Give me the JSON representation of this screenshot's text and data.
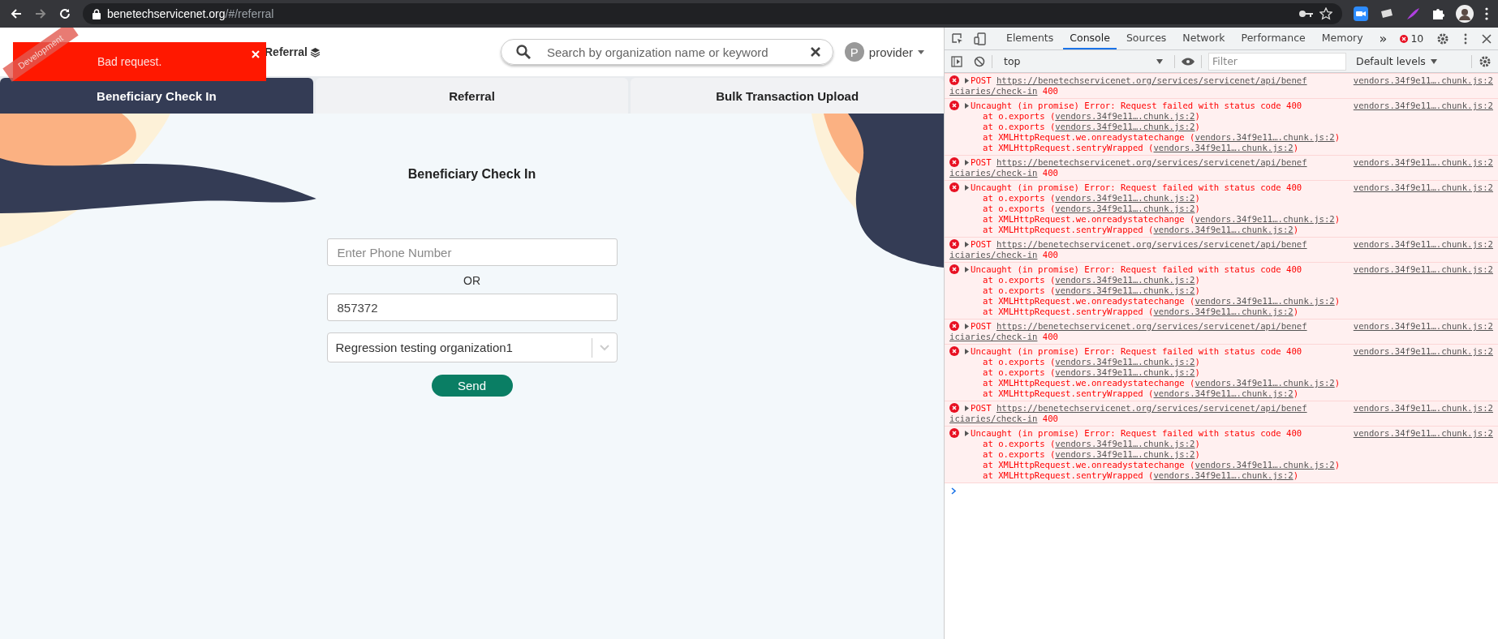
{
  "browser": {
    "url_host": "benetechservicenet.org",
    "url_path": "/#/referral"
  },
  "ribbon": {
    "label": "Development"
  },
  "toast": {
    "message": "Bad request."
  },
  "header": {
    "nav_link": "Referral",
    "search": {
      "placeholder": "Search by organization name or keyword"
    },
    "user": {
      "initial": "P",
      "name": "provider"
    }
  },
  "tabs": [
    {
      "label": "Beneficiary Check In",
      "selected": true
    },
    {
      "label": "Referral",
      "selected": false
    },
    {
      "label": "Bulk Transaction Upload",
      "selected": false
    }
  ],
  "form": {
    "title": "Beneficiary Check In",
    "phone": {
      "placeholder": "Enter Phone Number"
    },
    "separator": "OR",
    "beneficiary_id": {
      "value": "857372"
    },
    "organization": {
      "value": "Regression testing organization1"
    },
    "submit": "Send"
  },
  "devtools": {
    "tabs": [
      {
        "label": "Elements",
        "selected": false
      },
      {
        "label": "Console",
        "selected": true
      },
      {
        "label": "Sources",
        "selected": false
      },
      {
        "label": "Network",
        "selected": false
      },
      {
        "label": "Performance",
        "selected": false
      },
      {
        "label": "Memory",
        "selected": false
      }
    ],
    "more": "»",
    "error_count": "10",
    "context": "top",
    "filter": {
      "placeholder": "Filter"
    },
    "levels": "Default levels",
    "messages": [
      {
        "kind": "request",
        "method": "POST",
        "url_lines": [
          "https://benetechservicenet.org/services/servicenet/api/benef",
          "iciaries/check-in"
        ],
        "status": "400",
        "source": "vendors.34f9e11….chunk.js:2"
      },
      {
        "kind": "error",
        "message": "Uncaught (in promise) Error: Request failed with status code 400",
        "source": "vendors.34f9e11….chunk.js:2",
        "frames": [
          {
            "call": "at o.exports (",
            "src": "vendors.34f9e11….chunk.js:2",
            "close": ")"
          },
          {
            "call": "at o.exports (",
            "src": "vendors.34f9e11….chunk.js:2",
            "close": ")"
          },
          {
            "call": "at XMLHttpRequest.we.onreadystatechange (",
            "src": "vendors.34f9e11….chunk.js:2",
            "close": ")"
          },
          {
            "call": "at XMLHttpRequest.sentryWrapped (",
            "src": "vendors.34f9e11….chunk.js:2",
            "close": ")"
          }
        ]
      },
      {
        "kind": "request",
        "method": "POST",
        "url_lines": [
          "https://benetechservicenet.org/services/servicenet/api/benef",
          "iciaries/check-in"
        ],
        "status": "400",
        "source": "vendors.34f9e11….chunk.js:2"
      },
      {
        "kind": "error",
        "message": "Uncaught (in promise) Error: Request failed with status code 400",
        "source": "vendors.34f9e11….chunk.js:2",
        "frames": [
          {
            "call": "at o.exports (",
            "src": "vendors.34f9e11….chunk.js:2",
            "close": ")"
          },
          {
            "call": "at o.exports (",
            "src": "vendors.34f9e11….chunk.js:2",
            "close": ")"
          },
          {
            "call": "at XMLHttpRequest.we.onreadystatechange (",
            "src": "vendors.34f9e11….chunk.js:2",
            "close": ")"
          },
          {
            "call": "at XMLHttpRequest.sentryWrapped (",
            "src": "vendors.34f9e11….chunk.js:2",
            "close": ")"
          }
        ]
      },
      {
        "kind": "request",
        "method": "POST",
        "url_lines": [
          "https://benetechservicenet.org/services/servicenet/api/benef",
          "iciaries/check-in"
        ],
        "status": "400",
        "source": "vendors.34f9e11….chunk.js:2"
      },
      {
        "kind": "error",
        "message": "Uncaught (in promise) Error: Request failed with status code 400",
        "source": "vendors.34f9e11….chunk.js:2",
        "frames": [
          {
            "call": "at o.exports (",
            "src": "vendors.34f9e11….chunk.js:2",
            "close": ")"
          },
          {
            "call": "at o.exports (",
            "src": "vendors.34f9e11….chunk.js:2",
            "close": ")"
          },
          {
            "call": "at XMLHttpRequest.we.onreadystatechange (",
            "src": "vendors.34f9e11….chunk.js:2",
            "close": ")"
          },
          {
            "call": "at XMLHttpRequest.sentryWrapped (",
            "src": "vendors.34f9e11….chunk.js:2",
            "close": ")"
          }
        ]
      },
      {
        "kind": "request",
        "method": "POST",
        "url_lines": [
          "https://benetechservicenet.org/services/servicenet/api/benef",
          "iciaries/check-in"
        ],
        "status": "400",
        "source": "vendors.34f9e11….chunk.js:2"
      },
      {
        "kind": "error",
        "message": "Uncaught (in promise) Error: Request failed with status code 400",
        "source": "vendors.34f9e11….chunk.js:2",
        "frames": [
          {
            "call": "at o.exports (",
            "src": "vendors.34f9e11….chunk.js:2",
            "close": ")"
          },
          {
            "call": "at o.exports (",
            "src": "vendors.34f9e11….chunk.js:2",
            "close": ")"
          },
          {
            "call": "at XMLHttpRequest.we.onreadystatechange (",
            "src": "vendors.34f9e11….chunk.js:2",
            "close": ")"
          },
          {
            "call": "at XMLHttpRequest.sentryWrapped (",
            "src": "vendors.34f9e11….chunk.js:2",
            "close": ")"
          }
        ]
      },
      {
        "kind": "request",
        "method": "POST",
        "url_lines": [
          "https://benetechservicenet.org/services/servicenet/api/benef",
          "iciaries/check-in"
        ],
        "status": "400",
        "source": "vendors.34f9e11….chunk.js:2"
      },
      {
        "kind": "error",
        "message": "Uncaught (in promise) Error: Request failed with status code 400",
        "source": "vendors.34f9e11….chunk.js:2",
        "frames": [
          {
            "call": "at o.exports (",
            "src": "vendors.34f9e11….chunk.js:2",
            "close": ")"
          },
          {
            "call": "at o.exports (",
            "src": "vendors.34f9e11….chunk.js:2",
            "close": ")"
          },
          {
            "call": "at XMLHttpRequest.we.onreadystatechange (",
            "src": "vendors.34f9e11….chunk.js:2",
            "close": ")"
          },
          {
            "call": "at XMLHttpRequest.sentryWrapped (",
            "src": "vendors.34f9e11….chunk.js:2",
            "close": ")"
          }
        ]
      }
    ]
  }
}
